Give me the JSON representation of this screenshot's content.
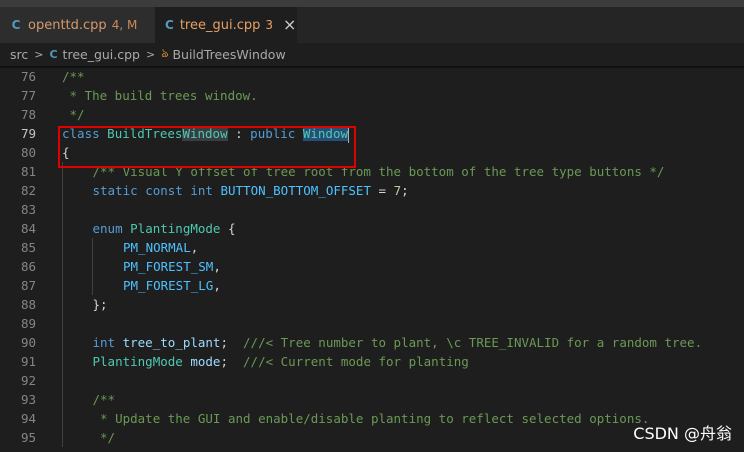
{
  "tabs": [
    {
      "icon": "C",
      "name": "openttd.cpp",
      "badge": "4, M",
      "active": false
    },
    {
      "icon": "C",
      "name": "tree_gui.cpp",
      "badge": "3",
      "active": true
    }
  ],
  "breadcrumb": {
    "folder": "src",
    "file": "tree_gui.cpp",
    "symbol": "BuildTreesWindow"
  },
  "lines": [
    {
      "n": "76",
      "t": "/**"
    },
    {
      "n": "77",
      "t": " * The build trees window."
    },
    {
      "n": "78",
      "t": " */"
    },
    {
      "n": "79",
      "t": "class BuildTreesWindow : public Window"
    },
    {
      "n": "80",
      "t": "{"
    },
    {
      "n": "81",
      "t": "\t/** Visual Y offset of tree root from the bottom of the tree type buttons */"
    },
    {
      "n": "82",
      "t": "\tstatic const int BUTTON_BOTTOM_OFFSET = 7;"
    },
    {
      "n": "83",
      "t": ""
    },
    {
      "n": "84",
      "t": "\tenum PlantingMode {"
    },
    {
      "n": "85",
      "t": "\t\tPM_NORMAL,"
    },
    {
      "n": "86",
      "t": "\t\tPM_FOREST_SM,"
    },
    {
      "n": "87",
      "t": "\t\tPM_FOREST_LG,"
    },
    {
      "n": "88",
      "t": "\t};"
    },
    {
      "n": "89",
      "t": ""
    },
    {
      "n": "90",
      "t": "\tint tree_to_plant;  ///< Tree number to plant, \\c TREE_INVALID for a random tree."
    },
    {
      "n": "91",
      "t": "\tPlantingMode mode;  ///< Current mode for planting"
    },
    {
      "n": "92",
      "t": ""
    },
    {
      "n": "93",
      "t": "\t/**"
    },
    {
      "n": "94",
      "t": "\t * Update the GUI and enable/disable planting to reflect selected options."
    },
    {
      "n": "95",
      "t": "\t */"
    }
  ],
  "watermark": "CSDN @舟翁"
}
